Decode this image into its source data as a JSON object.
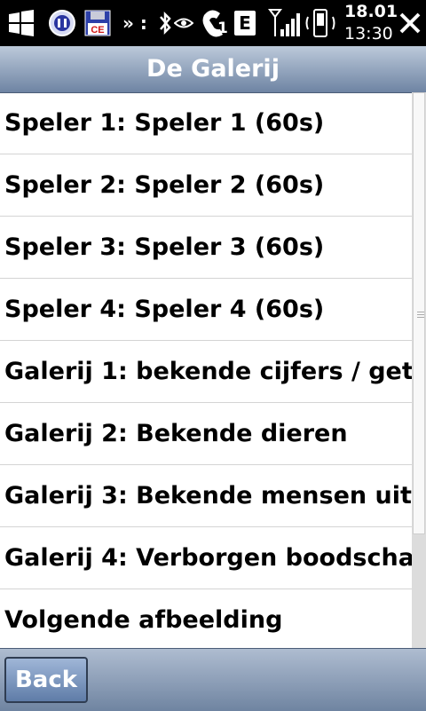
{
  "status_bar": {
    "date": "18.01",
    "time": "13:30",
    "call_count": "1",
    "network_type": "E",
    "more_icons": "» :",
    "icons": [
      "windows-start-icon",
      "app-icon",
      "ce-save-icon",
      "bluetooth-icon",
      "phone-icon",
      "network-e-icon",
      "signal-icon",
      "battery-phone-icon",
      "close-icon"
    ]
  },
  "title": "De Galerij",
  "list": {
    "items": [
      "Speler 1: Speler 1 (60s)",
      "Speler 2: Speler 2 (60s)",
      "Speler 3: Speler 3 (60s)",
      "Speler 4: Speler 4 (60s)",
      "Galerij 1: bekende cijfers / get",
      "Galerij 2: Bekende dieren",
      "Galerij 3: Bekende mensen uit",
      "Galerij 4: Verborgen boodscha",
      "Volgende afbeelding"
    ]
  },
  "bottom_bar": {
    "back_label": "Back"
  },
  "colors": {
    "title_bar": "#6e84a3",
    "bottom_bar": "#6f84a1",
    "back_button": "#5f7ca8"
  }
}
